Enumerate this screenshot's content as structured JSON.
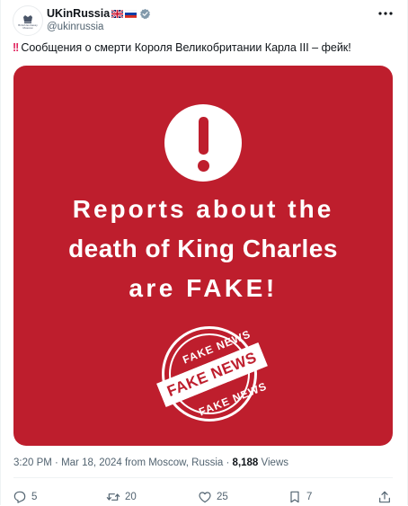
{
  "author": {
    "display_name": "UKinRussia",
    "handle": "@ukinrussia",
    "avatar_text": "British Embassy Moscow",
    "flags": [
      "uk-flag",
      "russia-flag"
    ],
    "verified": true
  },
  "tweet": {
    "text": "Сообщения о смерти Короля Великобритании Карла III – фейк!"
  },
  "media": {
    "line1": "Reports about the",
    "line2": "death of King Charles",
    "line3": "are FAKE!",
    "stamp_top": "FAKE NEWS",
    "stamp_center": "FAKE NEWS",
    "stamp_bottom": "FAKE NEWS",
    "background_color": "#be1e2d"
  },
  "meta": {
    "time": "3:20 PM",
    "date": "Mar 18, 2024",
    "location": "from Moscow, Russia",
    "views_count": "8,188",
    "views_label": "Views"
  },
  "actions": {
    "replies": "5",
    "reposts": "20",
    "likes": "25",
    "bookmarks": "7"
  },
  "colors": {
    "accent": "#1d9bf0",
    "muted_text": "#536471"
  }
}
